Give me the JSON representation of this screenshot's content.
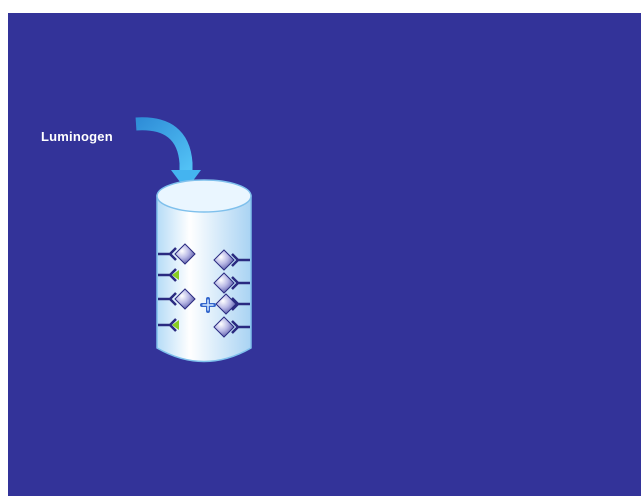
{
  "slide": {
    "background_color": "#333399",
    "label": "Luminogen",
    "arrow_color": "#33aaee",
    "tube": {
      "fill_top": "#e6f4ff",
      "fill_body": "#cfe9fb",
      "outline": "#6fb6e8",
      "icons": [
        "antibody-icon",
        "antigen-icon",
        "enzyme-icon",
        "luminogen-molecule-icon"
      ]
    },
    "colors": {
      "antibody": "#2a2a80",
      "antigen": "#7070b8",
      "enzyme": "#88cc22",
      "luminogen": "#3366cc"
    }
  }
}
